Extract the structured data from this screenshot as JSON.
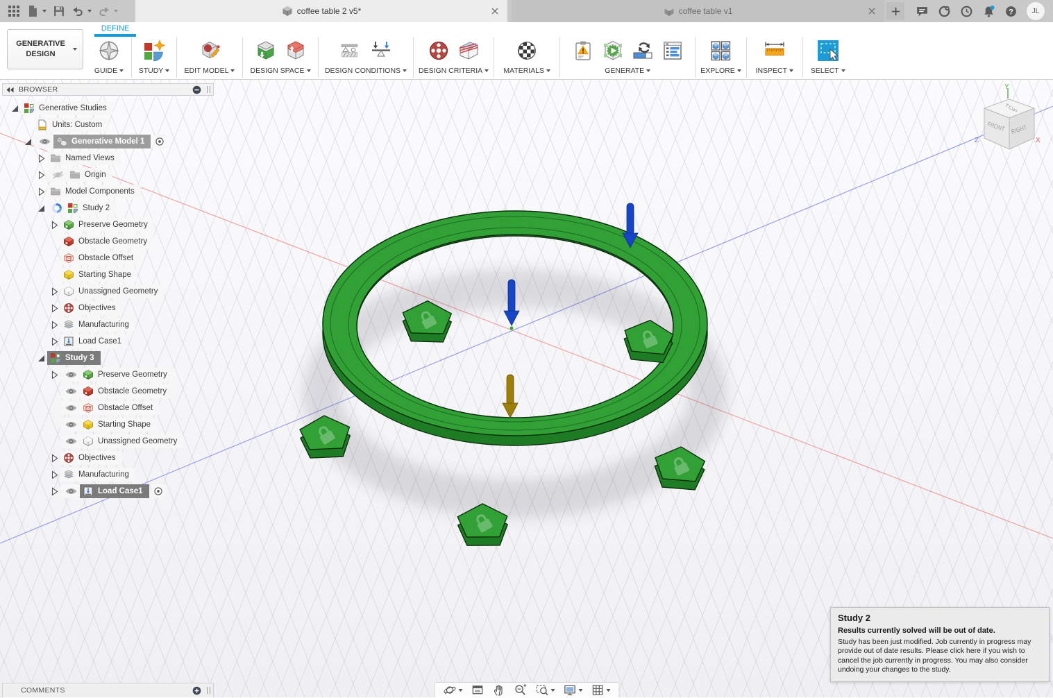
{
  "titlebar": {
    "tabs": [
      {
        "label": "coffee table 2 v5*",
        "active": true
      },
      {
        "label": "coffee table v1",
        "active": false
      }
    ],
    "avatar": "JL"
  },
  "ribbon": {
    "workspace": "GENERATIVE DESIGN",
    "tab": "DEFINE",
    "groups": [
      {
        "label": "GUIDE",
        "icons": [
          "compass"
        ]
      },
      {
        "label": "STUDY",
        "icons": [
          "new-study"
        ]
      },
      {
        "label": "EDIT MODEL",
        "icons": [
          "edit-model"
        ]
      },
      {
        "label": "DESIGN SPACE",
        "icons": [
          "preserve-space",
          "obstacle-space"
        ]
      },
      {
        "label": "DESIGN CONDITIONS",
        "icons": [
          "constraints",
          "loads"
        ]
      },
      {
        "label": "DESIGN CRITERIA",
        "icons": [
          "objectives",
          "criteria-volume"
        ]
      },
      {
        "label": "MATERIALS",
        "icons": [
          "materials"
        ]
      },
      {
        "label": "GENERATE",
        "icons": [
          "pre-check",
          "generate",
          "job-status",
          "explore-results"
        ]
      },
      {
        "label": "EXPLORE",
        "icons": [
          "explore"
        ]
      },
      {
        "label": "INSPECT",
        "icons": [
          "measure"
        ]
      },
      {
        "label": "SELECT",
        "icons": [
          "select"
        ]
      }
    ]
  },
  "browser": {
    "title": "BROWSER",
    "items": [
      {
        "label": "Generative Studies",
        "icon": "studies",
        "expander": "open",
        "indent": 0
      },
      {
        "label": "Units: Custom",
        "icon": "units-doc",
        "expander": "none",
        "indent": 1
      },
      {
        "label": "Generative Model 1",
        "icon": "model-cubes",
        "expander": "open",
        "indent": 1,
        "eye": true,
        "selected": "mid",
        "radio": true
      },
      {
        "label": "Named Views",
        "icon": "folder",
        "expander": "closed",
        "indent": 2
      },
      {
        "label": "Origin",
        "icon": "folder",
        "expander": "closed",
        "indent": 2,
        "eyeslash": true
      },
      {
        "label": "Model Components",
        "icon": "folder",
        "expander": "closed",
        "indent": 2
      },
      {
        "label": "Study 2",
        "icon": "studies",
        "expander": "open",
        "indent": 2,
        "spinner": true
      },
      {
        "label": "Preserve Geometry",
        "icon": "cube-green",
        "expander": "closed",
        "indent": 3
      },
      {
        "label": "Obstacle Geometry",
        "icon": "cube-red",
        "expander": "none",
        "indent": 3
      },
      {
        "label": "Obstacle Offset",
        "icon": "cube-red-outline",
        "expander": "none",
        "indent": 3
      },
      {
        "label": "Starting Shape",
        "icon": "cube-yellow",
        "expander": "none",
        "indent": 3
      },
      {
        "label": "Unassigned Geometry",
        "icon": "cube-white",
        "expander": "closed",
        "indent": 3
      },
      {
        "label": "Objectives",
        "icon": "target",
        "expander": "closed",
        "indent": 3
      },
      {
        "label": "Manufacturing",
        "icon": "layers",
        "expander": "closed",
        "indent": 3
      },
      {
        "label": "Load Case1",
        "icon": "loadcase",
        "expander": "closed",
        "indent": 3
      },
      {
        "label": "Study 3",
        "icon": "studies",
        "expander": "open",
        "indent": 2,
        "selected": "dark"
      },
      {
        "label": "Preserve Geometry",
        "icon": "cube-green",
        "expander": "closed",
        "indent": 3,
        "eye": true
      },
      {
        "label": "Obstacle Geometry",
        "icon": "cube-red",
        "expander": "none",
        "indent": 3,
        "eye": true
      },
      {
        "label": "Obstacle Offset",
        "icon": "cube-red-outline",
        "expander": "none",
        "indent": 3,
        "eye": true
      },
      {
        "label": "Starting Shape",
        "icon": "cube-yellow",
        "expander": "none",
        "indent": 3,
        "eye": true
      },
      {
        "label": "Unassigned Geometry",
        "icon": "cube-white",
        "expander": "none",
        "indent": 3,
        "eye": true
      },
      {
        "label": "Objectives",
        "icon": "target",
        "expander": "closed",
        "indent": 3
      },
      {
        "label": "Manufacturing",
        "icon": "layers",
        "expander": "closed",
        "indent": 3
      },
      {
        "label": "Load Case1",
        "icon": "loadcase",
        "expander": "closed",
        "indent": 3,
        "eye": true,
        "selected": "dark",
        "radio": true
      }
    ]
  },
  "viewcube": {
    "top": "TOP",
    "front": "FRONT",
    "right": "RIGHT",
    "x": "X",
    "y": "Y",
    "z": "Z"
  },
  "notification": {
    "title": "Study 2",
    "subtitle": "Results currently solved will be out of date.",
    "body": "Study has been just modified. Job currently in progress may provide out of date results. Please click here if you wish to cancel the job currently in progress. You may also consider undoing your changes to the study."
  },
  "comments": {
    "title": "COMMENTS"
  },
  "colors": {
    "accent_blue": "#169bd5",
    "model_green_top": "#31a135",
    "model_green_side": "#1e7d24",
    "model_green_edge": "#0d3010",
    "arrow_blue": "#1745c8",
    "arrow_olive": "#9c7f07",
    "axis_red": "#e87878",
    "axis_blue": "#7a80e6",
    "select_blue": "#1e9bd7"
  }
}
